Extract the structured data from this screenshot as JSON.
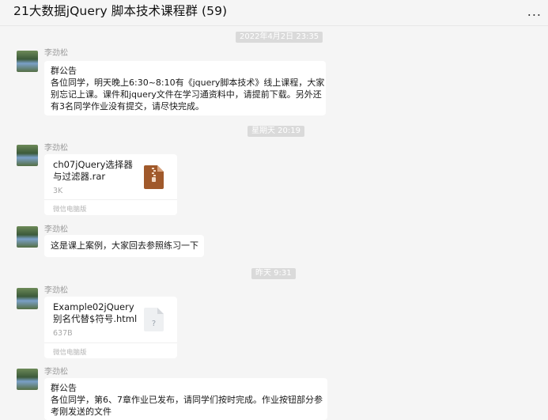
{
  "header": {
    "title": "21大数据jQuery 脚本技术课程群 (59)",
    "more": "..."
  },
  "timestamps": [
    "2022年4月2日 23:35",
    "星期天 20:19",
    "昨天 9:31"
  ],
  "messages": [
    {
      "sender": "李劲松",
      "type": "text",
      "lines": [
        "群公告",
        "各位同学，明天晚上6:30~8:10有《jquery脚本技术》线上课程，大家",
        "别忘记上课。课件和jquery文件在学习通资料中，请提前下载。另外还",
        "有3名同学作业没有提交，请尽快完成。"
      ]
    },
    {
      "sender": "李劲松",
      "type": "file",
      "name_lines": [
        "ch07jQuery选择器",
        "与过滤器.rar"
      ],
      "size": "3K",
      "source": "微信电脑版",
      "icon": "zip-file-icon"
    },
    {
      "sender": "李劲松",
      "type": "text",
      "lines": [
        "这是课上案例，大家回去参照练习一下"
      ]
    },
    {
      "sender": "李劲松",
      "type": "file",
      "name_lines": [
        "Example02jQuery",
        "别名代替$符号.html"
      ],
      "size": "637B",
      "source": "微信电脑版",
      "icon": "unknown-file-icon",
      "icon_glyph": "?"
    },
    {
      "sender": "李劲松",
      "type": "text",
      "lines": [
        "群公告",
        "各位同学，第6、7章作业已发布，请同学们按时完成。作业按钮部分参",
        "考刚发送的文件"
      ]
    }
  ]
}
